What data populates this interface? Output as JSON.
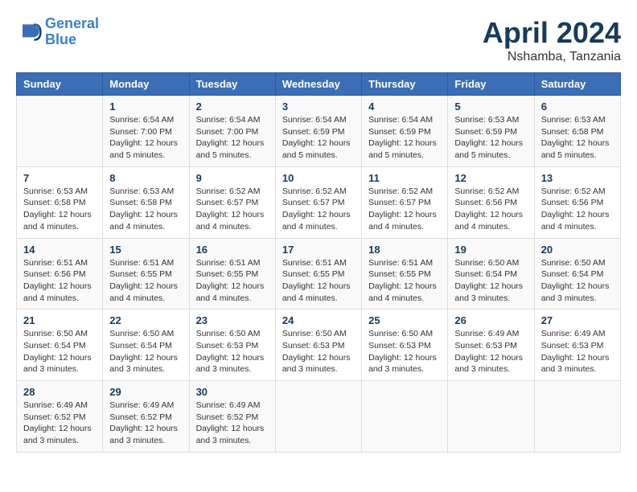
{
  "header": {
    "logo_line1": "General",
    "logo_line2": "Blue",
    "month": "April 2024",
    "location": "Nshamba, Tanzania"
  },
  "weekdays": [
    "Sunday",
    "Monday",
    "Tuesday",
    "Wednesday",
    "Thursday",
    "Friday",
    "Saturday"
  ],
  "weeks": [
    [
      {
        "day": "",
        "info": ""
      },
      {
        "day": "1",
        "info": "Sunrise: 6:54 AM\nSunset: 7:00 PM\nDaylight: 12 hours\nand 5 minutes."
      },
      {
        "day": "2",
        "info": "Sunrise: 6:54 AM\nSunset: 7:00 PM\nDaylight: 12 hours\nand 5 minutes."
      },
      {
        "day": "3",
        "info": "Sunrise: 6:54 AM\nSunset: 6:59 PM\nDaylight: 12 hours\nand 5 minutes."
      },
      {
        "day": "4",
        "info": "Sunrise: 6:54 AM\nSunset: 6:59 PM\nDaylight: 12 hours\nand 5 minutes."
      },
      {
        "day": "5",
        "info": "Sunrise: 6:53 AM\nSunset: 6:59 PM\nDaylight: 12 hours\nand 5 minutes."
      },
      {
        "day": "6",
        "info": "Sunrise: 6:53 AM\nSunset: 6:58 PM\nDaylight: 12 hours\nand 5 minutes."
      }
    ],
    [
      {
        "day": "7",
        "info": "Sunrise: 6:53 AM\nSunset: 6:58 PM\nDaylight: 12 hours\nand 4 minutes."
      },
      {
        "day": "8",
        "info": "Sunrise: 6:53 AM\nSunset: 6:58 PM\nDaylight: 12 hours\nand 4 minutes."
      },
      {
        "day": "9",
        "info": "Sunrise: 6:52 AM\nSunset: 6:57 PM\nDaylight: 12 hours\nand 4 minutes."
      },
      {
        "day": "10",
        "info": "Sunrise: 6:52 AM\nSunset: 6:57 PM\nDaylight: 12 hours\nand 4 minutes."
      },
      {
        "day": "11",
        "info": "Sunrise: 6:52 AM\nSunset: 6:57 PM\nDaylight: 12 hours\nand 4 minutes."
      },
      {
        "day": "12",
        "info": "Sunrise: 6:52 AM\nSunset: 6:56 PM\nDaylight: 12 hours\nand 4 minutes."
      },
      {
        "day": "13",
        "info": "Sunrise: 6:52 AM\nSunset: 6:56 PM\nDaylight: 12 hours\nand 4 minutes."
      }
    ],
    [
      {
        "day": "14",
        "info": "Sunrise: 6:51 AM\nSunset: 6:56 PM\nDaylight: 12 hours\nand 4 minutes."
      },
      {
        "day": "15",
        "info": "Sunrise: 6:51 AM\nSunset: 6:55 PM\nDaylight: 12 hours\nand 4 minutes."
      },
      {
        "day": "16",
        "info": "Sunrise: 6:51 AM\nSunset: 6:55 PM\nDaylight: 12 hours\nand 4 minutes."
      },
      {
        "day": "17",
        "info": "Sunrise: 6:51 AM\nSunset: 6:55 PM\nDaylight: 12 hours\nand 4 minutes."
      },
      {
        "day": "18",
        "info": "Sunrise: 6:51 AM\nSunset: 6:55 PM\nDaylight: 12 hours\nand 4 minutes."
      },
      {
        "day": "19",
        "info": "Sunrise: 6:50 AM\nSunset: 6:54 PM\nDaylight: 12 hours\nand 3 minutes."
      },
      {
        "day": "20",
        "info": "Sunrise: 6:50 AM\nSunset: 6:54 PM\nDaylight: 12 hours\nand 3 minutes."
      }
    ],
    [
      {
        "day": "21",
        "info": "Sunrise: 6:50 AM\nSunset: 6:54 PM\nDaylight: 12 hours\nand 3 minutes."
      },
      {
        "day": "22",
        "info": "Sunrise: 6:50 AM\nSunset: 6:54 PM\nDaylight: 12 hours\nand 3 minutes."
      },
      {
        "day": "23",
        "info": "Sunrise: 6:50 AM\nSunset: 6:53 PM\nDaylight: 12 hours\nand 3 minutes."
      },
      {
        "day": "24",
        "info": "Sunrise: 6:50 AM\nSunset: 6:53 PM\nDaylight: 12 hours\nand 3 minutes."
      },
      {
        "day": "25",
        "info": "Sunrise: 6:50 AM\nSunset: 6:53 PM\nDaylight: 12 hours\nand 3 minutes."
      },
      {
        "day": "26",
        "info": "Sunrise: 6:49 AM\nSunset: 6:53 PM\nDaylight: 12 hours\nand 3 minutes."
      },
      {
        "day": "27",
        "info": "Sunrise: 6:49 AM\nSunset: 6:53 PM\nDaylight: 12 hours\nand 3 minutes."
      }
    ],
    [
      {
        "day": "28",
        "info": "Sunrise: 6:49 AM\nSunset: 6:52 PM\nDaylight: 12 hours\nand 3 minutes."
      },
      {
        "day": "29",
        "info": "Sunrise: 6:49 AM\nSunset: 6:52 PM\nDaylight: 12 hours\nand 3 minutes."
      },
      {
        "day": "30",
        "info": "Sunrise: 6:49 AM\nSunset: 6:52 PM\nDaylight: 12 hours\nand 3 minutes."
      },
      {
        "day": "",
        "info": ""
      },
      {
        "day": "",
        "info": ""
      },
      {
        "day": "",
        "info": ""
      },
      {
        "day": "",
        "info": ""
      }
    ]
  ]
}
